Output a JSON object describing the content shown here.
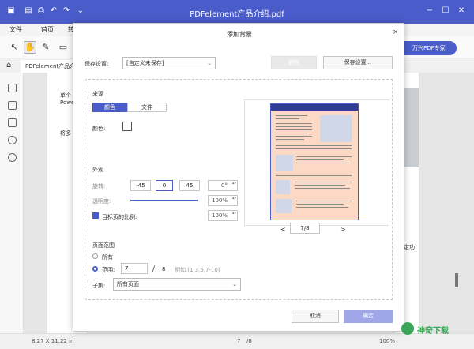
{
  "app": {
    "title": "PDFelement产品介绍.pdf"
  },
  "menu": {
    "file": "文件",
    "home": "首页",
    "more": "转"
  },
  "promo": {
    "label": "万兴PDF专家"
  },
  "tab": {
    "label": "PDFelement产品介..."
  },
  "doc": {
    "frag1": "单个",
    "frag2": "Powe",
    "frag3": "将多",
    "frag4": "适定功"
  },
  "status": {
    "size": "8.27 X 11.22 in",
    "page": "7",
    "total": "/8",
    "zoom": "100%"
  },
  "dialog": {
    "title": "添加背景",
    "close": "×",
    "settings_label": "保存设置:",
    "settings_value": "[自定义未保存]",
    "delete_label": "删除",
    "save_settings_label": "保存设置...",
    "source": {
      "heading": "来源",
      "tab_color": "颜色",
      "tab_file": "文件",
      "color_label": "颜色:"
    },
    "appearance": {
      "heading": "外观",
      "rotation_label": "旋转:",
      "rotate_neg": "-45",
      "rotate_zero": "0",
      "rotate_pos": "45",
      "rotate_value": "0°",
      "opacity_label": "透明度:",
      "opacity_value": "100%",
      "scale_label": "目标页的比例:",
      "scale_value": "100%"
    },
    "page_range": {
      "heading": "页面范围",
      "all_label": "所有",
      "range_label": "范围:",
      "range_from": "7",
      "range_sep": "/",
      "range_total": "8",
      "range_hint": "例如.(1,3,5,7-10)",
      "subset_label": "子集:",
      "subset_value": "所有页面"
    },
    "preview": {
      "page_value": "7",
      "page_total": "/8",
      "prev": "<",
      "next": ">"
    },
    "cancel_label": "取消",
    "ok_label": "确定"
  },
  "watermark": {
    "brand": "神奇下载"
  },
  "colors": {
    "accent": "#4a5cc9",
    "preview_bg": "#fbd9c4",
    "ok_btn": "#9fa7e8"
  }
}
